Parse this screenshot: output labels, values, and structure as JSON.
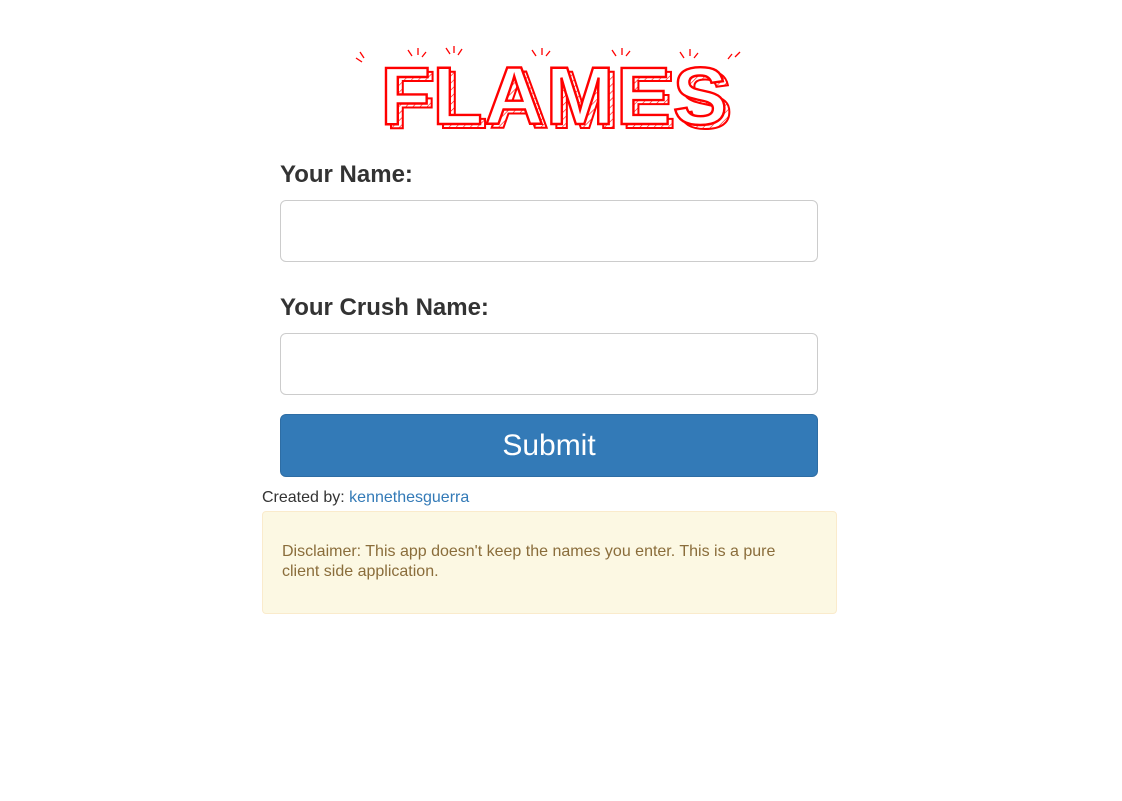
{
  "logo": {
    "text": "FLAMES",
    "color": "#ff0000"
  },
  "form": {
    "name_label": "Your Name:",
    "name_value": "",
    "crush_label": "Your Crush Name:",
    "crush_value": "",
    "submit_label": "Submit"
  },
  "credit": {
    "prefix": "Created by:",
    "author": "kennethesguerra"
  },
  "disclaimer": {
    "text": "Disclaimer: This app doesn't keep the names you enter. This is a pure client side application."
  },
  "colors": {
    "primary": "#337ab7",
    "alert_bg": "#fcf8e3",
    "alert_text": "#8a6d3b",
    "logo_red": "#ff0000"
  }
}
